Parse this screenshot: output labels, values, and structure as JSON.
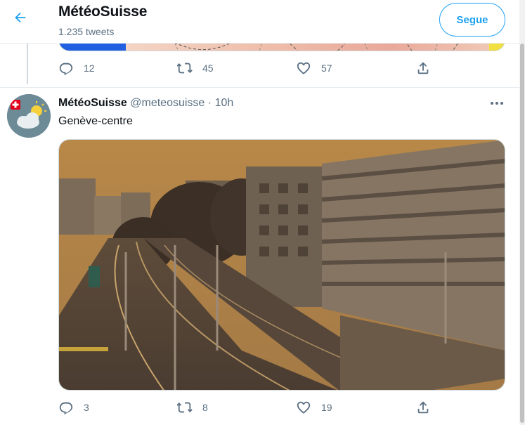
{
  "header": {
    "title": "MétéoSuisse",
    "subtitle": "1.235 tweets",
    "follow_label": "Segue"
  },
  "prev_tweet": {
    "actions": {
      "reply_count": "12",
      "retweet_count": "45",
      "like_count": "57"
    }
  },
  "tweet": {
    "name": "MétéoSuisse",
    "handle": "@meteosuisse",
    "separator": "·",
    "time": "10h",
    "text": "Genève-centre",
    "actions": {
      "reply_count": "3",
      "retweet_count": "8",
      "like_count": "19"
    }
  },
  "icons": {
    "back": "arrow-left-icon",
    "more": "more-dots-icon",
    "reply": "reply-icon",
    "retweet": "retweet-icon",
    "like": "heart-icon",
    "share": "share-icon"
  },
  "colors": {
    "accent": "#1da1f2",
    "secondary_text": "#5b7083",
    "photo_sky": "#b98a4e"
  }
}
